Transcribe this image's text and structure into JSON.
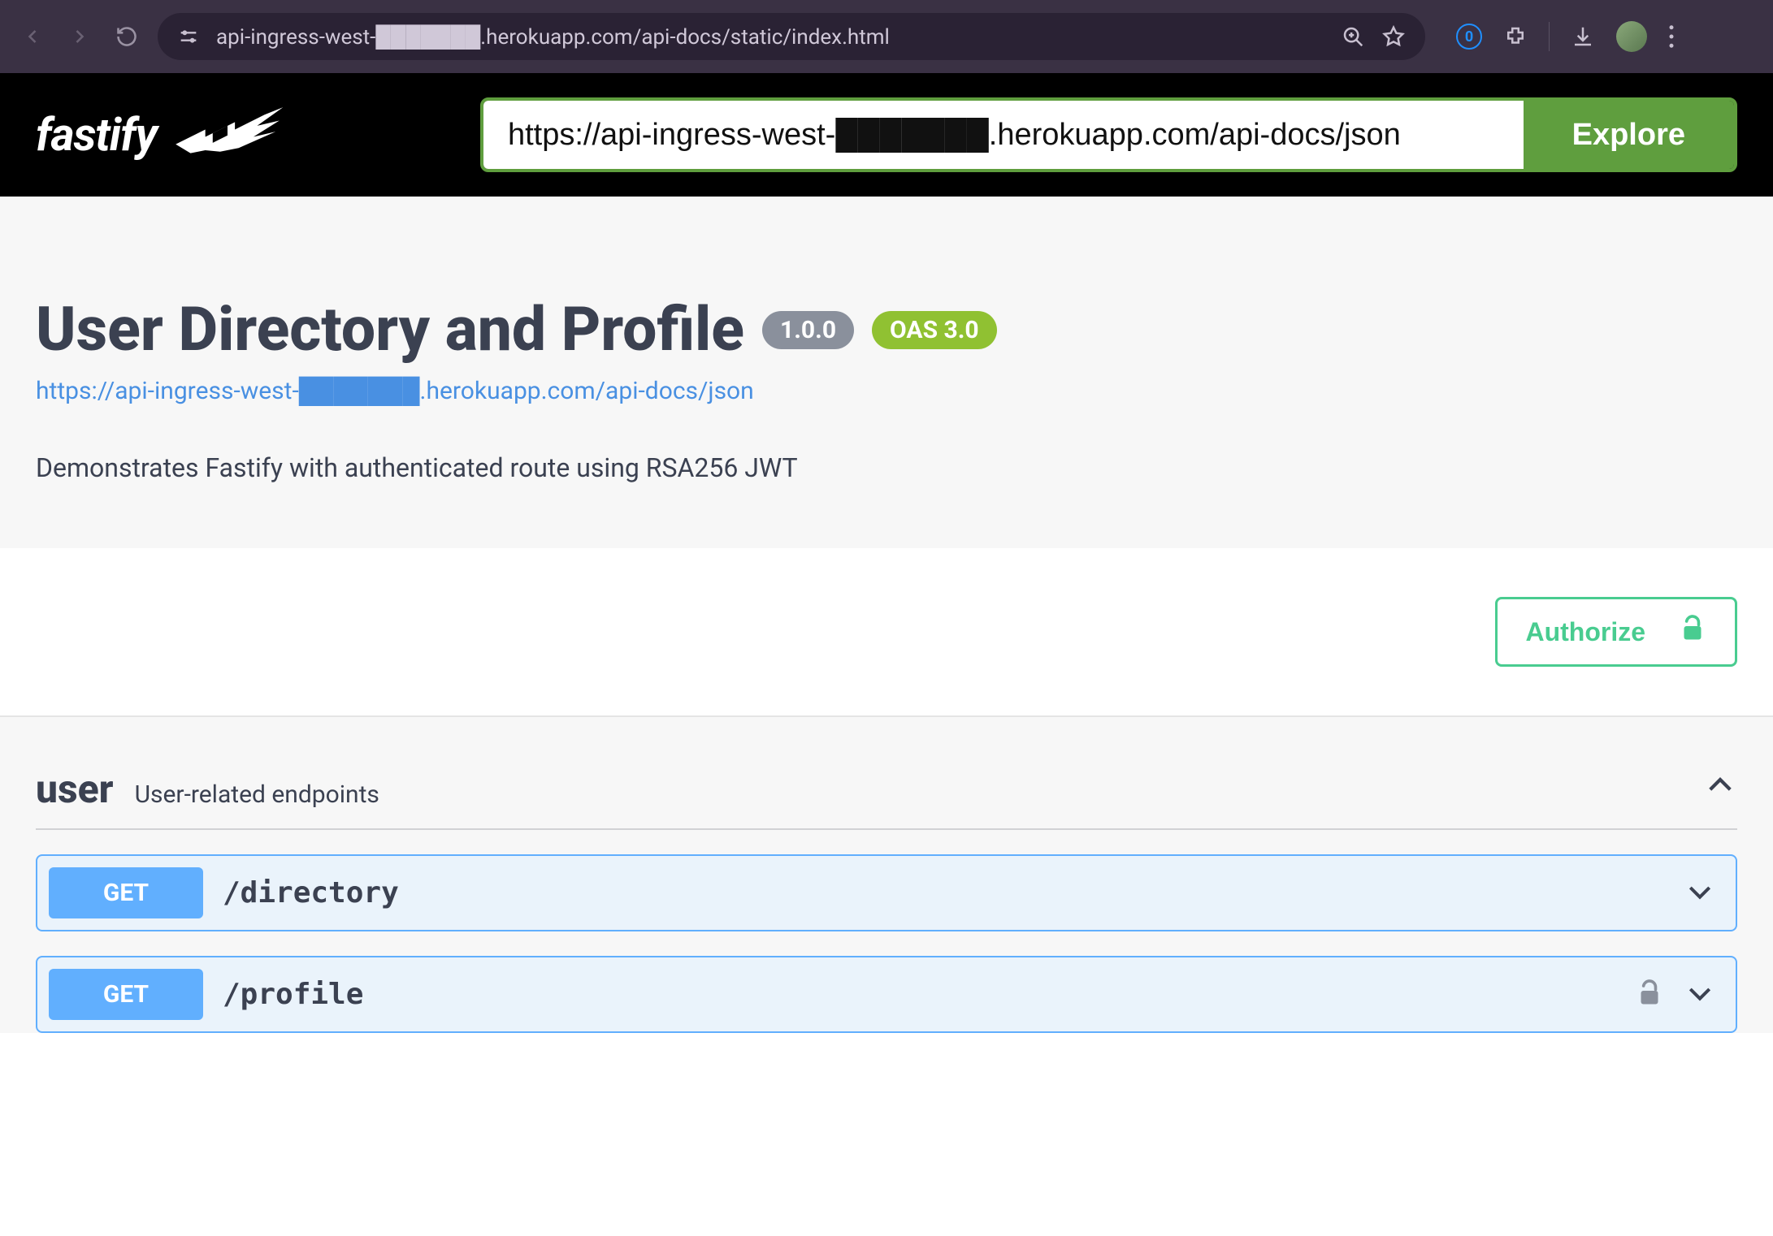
{
  "browser": {
    "url": "api-ingress-west-███████.herokuapp.com/api-docs/static/index.html"
  },
  "topbar": {
    "brand": "fastify",
    "spec_url": "https://api-ingress-west-███████.herokuapp.com/api-docs/json",
    "explore_label": "Explore"
  },
  "info": {
    "title": "User Directory and Profile",
    "version": "1.0.0",
    "oas": "OAS 3.0",
    "spec_link": "https://api-ingress-west-███████.herokuapp.com/api-docs/json",
    "description": "Demonstrates Fastify with authenticated route using RSA256 JWT"
  },
  "auth": {
    "authorize_label": "Authorize"
  },
  "tag": {
    "name": "user",
    "description": "User-related endpoints"
  },
  "operations": [
    {
      "method": "GET",
      "path": "/directory",
      "locked": false
    },
    {
      "method": "GET",
      "path": "/profile",
      "locked": true
    }
  ]
}
